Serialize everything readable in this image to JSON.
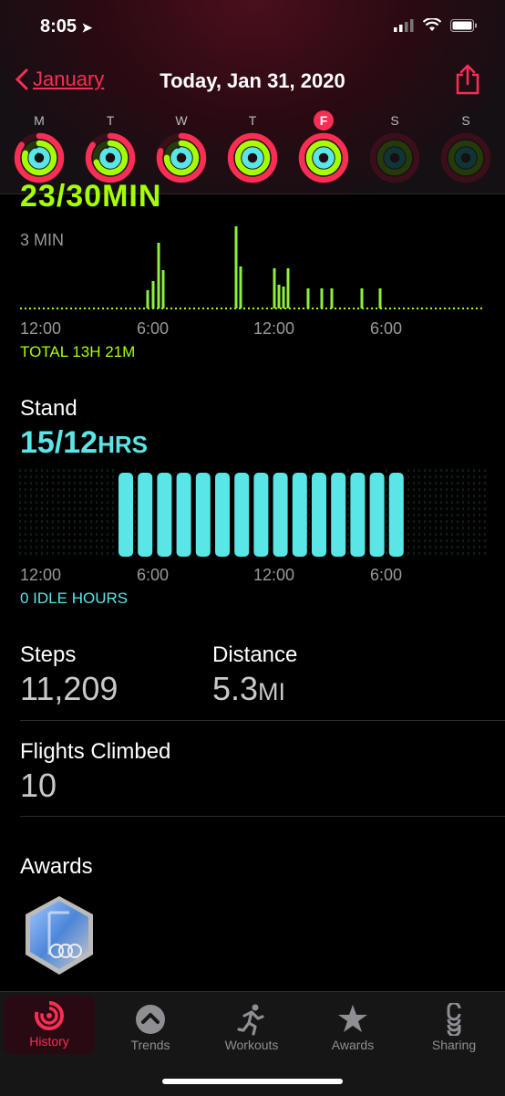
{
  "status": {
    "time": "8:05"
  },
  "nav": {
    "back_label": "January",
    "title": "Today, Jan 31, 2020"
  },
  "week": [
    {
      "letter": "M",
      "today": false
    },
    {
      "letter": "T",
      "today": false
    },
    {
      "letter": "W",
      "today": false
    },
    {
      "letter": "T",
      "today": false
    },
    {
      "letter": "F",
      "today": true
    },
    {
      "letter": "S",
      "today": false
    },
    {
      "letter": "S",
      "today": false
    }
  ],
  "exercise": {
    "value": "23/30MIN",
    "y_label": "3 MIN",
    "x_ticks": [
      "12:00",
      "6:00",
      "12:00",
      "6:00"
    ],
    "total": "TOTAL 13H 21M",
    "color": "#a6ff00"
  },
  "stand": {
    "title": "Stand",
    "value": "15/12",
    "unit": "HRS",
    "x_ticks": [
      "12:00",
      "6:00",
      "12:00",
      "6:00"
    ],
    "idle": "0 IDLE HOURS",
    "color": "#5ae6e6"
  },
  "steps": {
    "title": "Steps",
    "value": "11,209"
  },
  "distance": {
    "title": "Distance",
    "value": "5.3",
    "unit": "MI"
  },
  "flights": {
    "title": "Flights Climbed",
    "value": "10"
  },
  "awards": {
    "title": "Awards"
  },
  "tabs": [
    {
      "label": "History",
      "icon": "history-icon",
      "active": true
    },
    {
      "label": "Trends",
      "icon": "trends-icon",
      "active": false
    },
    {
      "label": "Workouts",
      "icon": "workouts-icon",
      "active": false
    },
    {
      "label": "Awards",
      "icon": "awards-icon",
      "active": false
    },
    {
      "label": "Sharing",
      "icon": "sharing-icon",
      "active": false
    }
  ]
}
